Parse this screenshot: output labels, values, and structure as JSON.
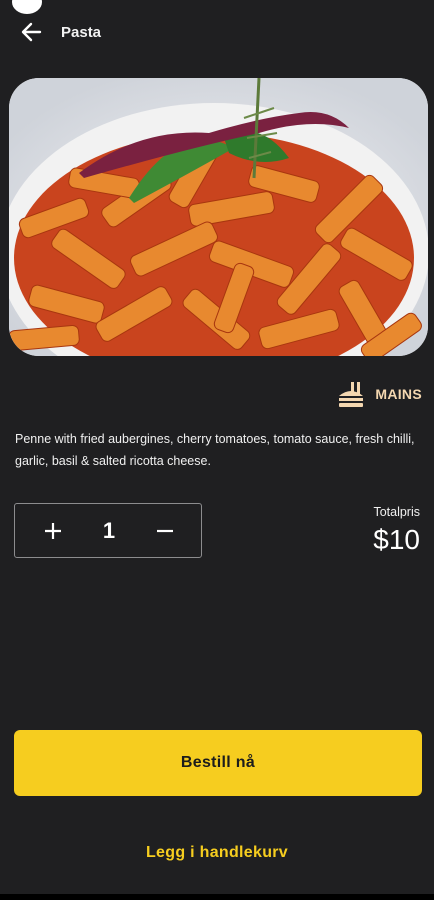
{
  "header": {
    "title": "Pasta"
  },
  "product": {
    "image_alt": "Penne pasta dish",
    "category": "MAINS",
    "description": "Penne with fried aubergines, cherry tomatoes, tomato sauce, fresh chilli, garlic, basil & salted ricotta cheese."
  },
  "quantity": {
    "value": "1",
    "increment_icon": "plus-icon",
    "decrement_icon": "minus-icon"
  },
  "total": {
    "label": "Totalpris",
    "price": "$10"
  },
  "actions": {
    "order_label": "Bestill nå",
    "cart_label": "Legg i handlekurv"
  },
  "colors": {
    "background": "#1f1f21",
    "accent": "#f6cd1f",
    "category": "#f4d7b0"
  }
}
